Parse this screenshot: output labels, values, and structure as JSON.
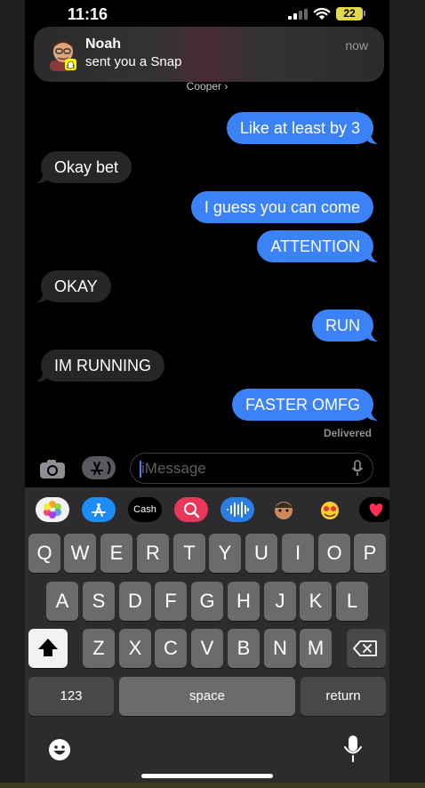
{
  "status_bar": {
    "time": "11:16",
    "battery": "22"
  },
  "notification": {
    "title": "Noah",
    "body": "sent you a Snap",
    "time": "now",
    "app_icon": "snapchat-ghost-icon"
  },
  "conversation": {
    "contact_label": "Cooper ›"
  },
  "messages": [
    {
      "text": "Like at least by 3",
      "from": "me"
    },
    {
      "text": "Okay bet",
      "from": "them"
    },
    {
      "text": "I guess you can come",
      "from": "me"
    },
    {
      "text": "ATTENTION",
      "from": "me"
    },
    {
      "text": "OKAY",
      "from": "them"
    },
    {
      "text": "RUN",
      "from": "me"
    },
    {
      "text": "IM RUNNING",
      "from": "them"
    },
    {
      "text": "FASTER OMFG",
      "from": "me"
    }
  ],
  "delivered_label": "Delivered",
  "composer": {
    "placeholder": "iMessage"
  },
  "app_drawer": {
    "items": [
      "photos-icon",
      "app-store-icon",
      "apple-cash-icon",
      "web-images-icon",
      "audio-message-icon",
      "memoji-icon",
      "animoji-icon",
      "digital-touch-icon"
    ],
    "cash_label": "Cash"
  },
  "keyboard": {
    "row1": [
      "Q",
      "W",
      "E",
      "R",
      "T",
      "Y",
      "U",
      "I",
      "O",
      "P"
    ],
    "row2": [
      "A",
      "S",
      "D",
      "F",
      "G",
      "H",
      "J",
      "K",
      "L"
    ],
    "row3": [
      "Z",
      "X",
      "C",
      "V",
      "B",
      "N",
      "M"
    ],
    "numbers_label": "123",
    "space_label": "space",
    "return_label": "return"
  },
  "colors": {
    "outgoing_bubble": "#3b82f6",
    "incoming_bubble": "#262628",
    "battery": "#e2d94a"
  }
}
